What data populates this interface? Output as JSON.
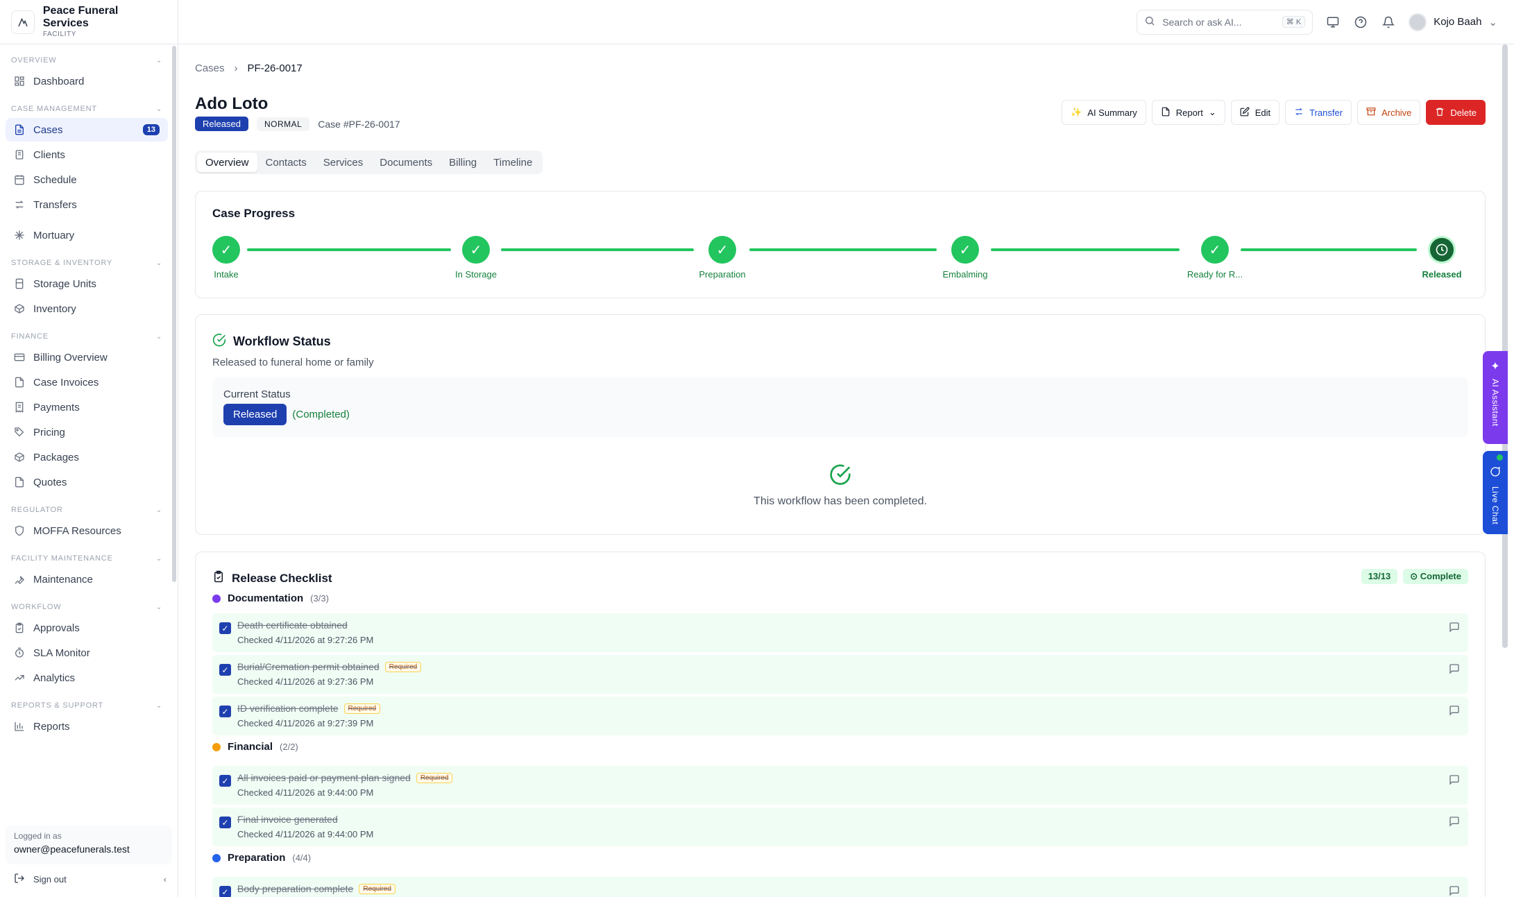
{
  "brand": {
    "name": "Peace Funeral Services",
    "sub": "FACILITY"
  },
  "sidebar": {
    "sections": [
      {
        "title": "OVERVIEW",
        "items": [
          {
            "label": "Dashboard"
          }
        ]
      },
      {
        "title": "CASE MANAGEMENT",
        "items": [
          {
            "label": "Cases",
            "badge": "13"
          },
          {
            "label": "Clients"
          },
          {
            "label": "Schedule"
          },
          {
            "label": "Transfers"
          },
          {
            "label": "Mortuary"
          }
        ]
      },
      {
        "title": "STORAGE & INVENTORY",
        "items": [
          {
            "label": "Storage Units"
          },
          {
            "label": "Inventory"
          }
        ]
      },
      {
        "title": "FINANCE",
        "items": [
          {
            "label": "Billing Overview"
          },
          {
            "label": "Case Invoices"
          },
          {
            "label": "Payments"
          },
          {
            "label": "Pricing"
          },
          {
            "label": "Packages"
          },
          {
            "label": "Quotes"
          }
        ]
      },
      {
        "title": "REGULATOR",
        "items": [
          {
            "label": "MOFFA Resources"
          }
        ]
      },
      {
        "title": "FACILITY MAINTENANCE",
        "items": [
          {
            "label": "Maintenance"
          }
        ]
      },
      {
        "title": "WORKFLOW",
        "items": [
          {
            "label": "Approvals"
          },
          {
            "label": "SLA Monitor"
          },
          {
            "label": "Analytics"
          }
        ]
      },
      {
        "title": "REPORTS & SUPPORT",
        "items": [
          {
            "label": "Reports"
          }
        ]
      }
    ],
    "logged_in_label": "Logged in as",
    "logged_in_email": "owner@peacefunerals.test",
    "signout": "Sign out"
  },
  "topbar": {
    "search_placeholder": "Search or ask AI...",
    "shortcut": "⌘ K",
    "user": "Kojo Baah"
  },
  "breadcrumb": {
    "parent": "Cases",
    "current": "PF-26-0017"
  },
  "case": {
    "name": "Ado Loto",
    "status": "Released",
    "priority": "NORMAL",
    "number": "Case #PF-26-0017"
  },
  "actions": {
    "ai_summary": "AI Summary",
    "report": "Report",
    "edit": "Edit",
    "transfer": "Transfer",
    "archive": "Archive",
    "delete": "Delete"
  },
  "tabs": [
    "Overview",
    "Contacts",
    "Services",
    "Documents",
    "Billing",
    "Timeline"
  ],
  "progress": {
    "title": "Case Progress",
    "steps": [
      "Intake",
      "In Storage",
      "Preparation",
      "Embalming",
      "Ready for R...",
      "Released"
    ]
  },
  "workflow": {
    "title": "Workflow Status",
    "subtitle": "Released to funeral home or family",
    "current_label": "Current Status",
    "current_value": "Released",
    "current_note": "(Completed)",
    "done_message": "This workflow has been completed."
  },
  "checklist": {
    "title": "Release Checklist",
    "count": "13/13",
    "complete": "Complete",
    "required_label": "Required",
    "groups": [
      {
        "name": "Documentation",
        "count": "(3/3)",
        "color": "#7c3aed",
        "items": [
          {
            "label": "Death certificate obtained",
            "required": false,
            "checked": "Checked 4/11/2026 at 9:27:26 PM"
          },
          {
            "label": "Burial/Cremation permit obtained",
            "required": true,
            "checked": "Checked 4/11/2026 at 9:27:36 PM"
          },
          {
            "label": "ID verification complete",
            "required": true,
            "checked": "Checked 4/11/2026 at 9:27:39 PM"
          }
        ]
      },
      {
        "name": "Financial",
        "count": "(2/2)",
        "color": "#f59e0b",
        "items": [
          {
            "label": "All invoices paid or payment plan signed",
            "required": true,
            "checked": "Checked 4/11/2026 at 9:44:00 PM"
          },
          {
            "label": "Final invoice generated",
            "required": false,
            "checked": "Checked 4/11/2026 at 9:44:00 PM"
          }
        ]
      },
      {
        "name": "Preparation",
        "count": "(4/4)",
        "color": "#2563eb",
        "items": [
          {
            "label": "Body preparation complete",
            "required": true,
            "checked": ""
          }
        ]
      }
    ]
  },
  "side": {
    "ai": "AI Assistant",
    "chat": "Live Chat"
  }
}
